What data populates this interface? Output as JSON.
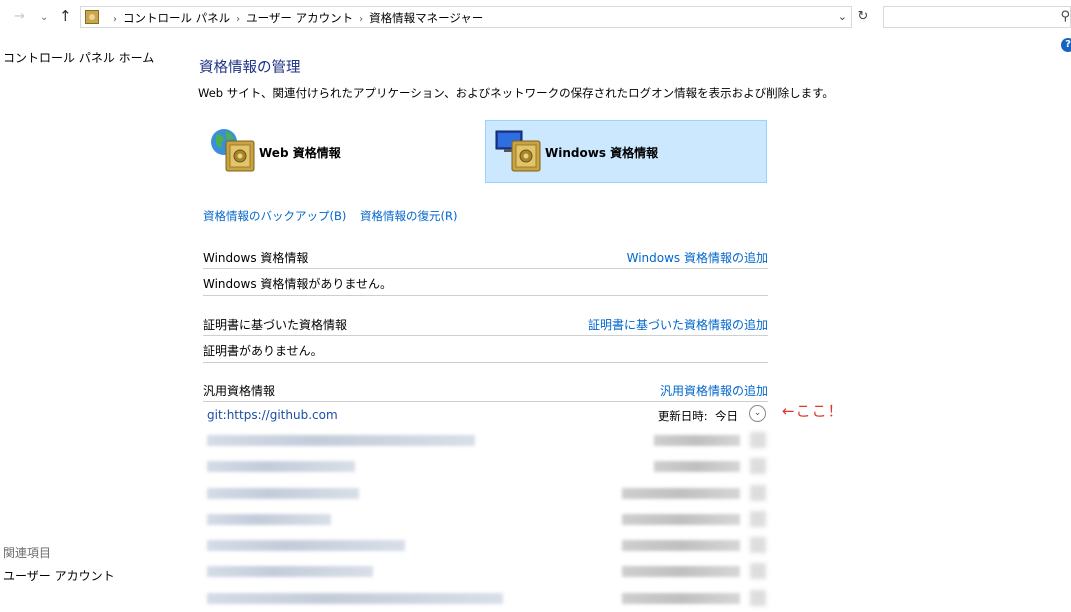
{
  "address_bar": {
    "breadcrumbs": [
      "コントロール パネル",
      "ユーザー アカウント",
      "資格情報マネージャー"
    ],
    "search_placeholder": ""
  },
  "sidebar": {
    "home_link": "コントロール パネル ホーム",
    "related_heading": "関連項目",
    "related_links": [
      "ユーザー アカウント"
    ]
  },
  "main": {
    "title": "資格情報の管理",
    "description": "Web サイト、関連付けられたアプリケーション、およびネットワークの保存されたログオン情報を表示および削除します。",
    "tiles": [
      {
        "label": "Web 資格情報",
        "selected": false
      },
      {
        "label": "Windows 資格情報",
        "selected": true
      }
    ],
    "links": {
      "backup": "資格情報のバックアップ(B)",
      "restore": "資格情報の復元(R)"
    },
    "sections": [
      {
        "title": "Windows 資格情報",
        "add_link": "Windows 資格情報の追加",
        "empty_text": "Windows 資格情報がありません。"
      },
      {
        "title": "証明書に基づいた資格情報",
        "add_link": "証明書に基づいた資格情報の追加",
        "empty_text": "証明書がありません。"
      },
      {
        "title": "汎用資格情報",
        "add_link": "汎用資格情報の追加"
      }
    ],
    "generic_credentials": [
      {
        "name": "git:https://github.com",
        "modified_label": "更新日時:",
        "modified_value": "今日"
      }
    ],
    "annotation": "←ここ！"
  },
  "colors": {
    "title_blue": "#1e3287",
    "link_blue": "#0066cc",
    "selected_tile_bg": "#cce8ff",
    "annotation_red": "#e0352b"
  }
}
